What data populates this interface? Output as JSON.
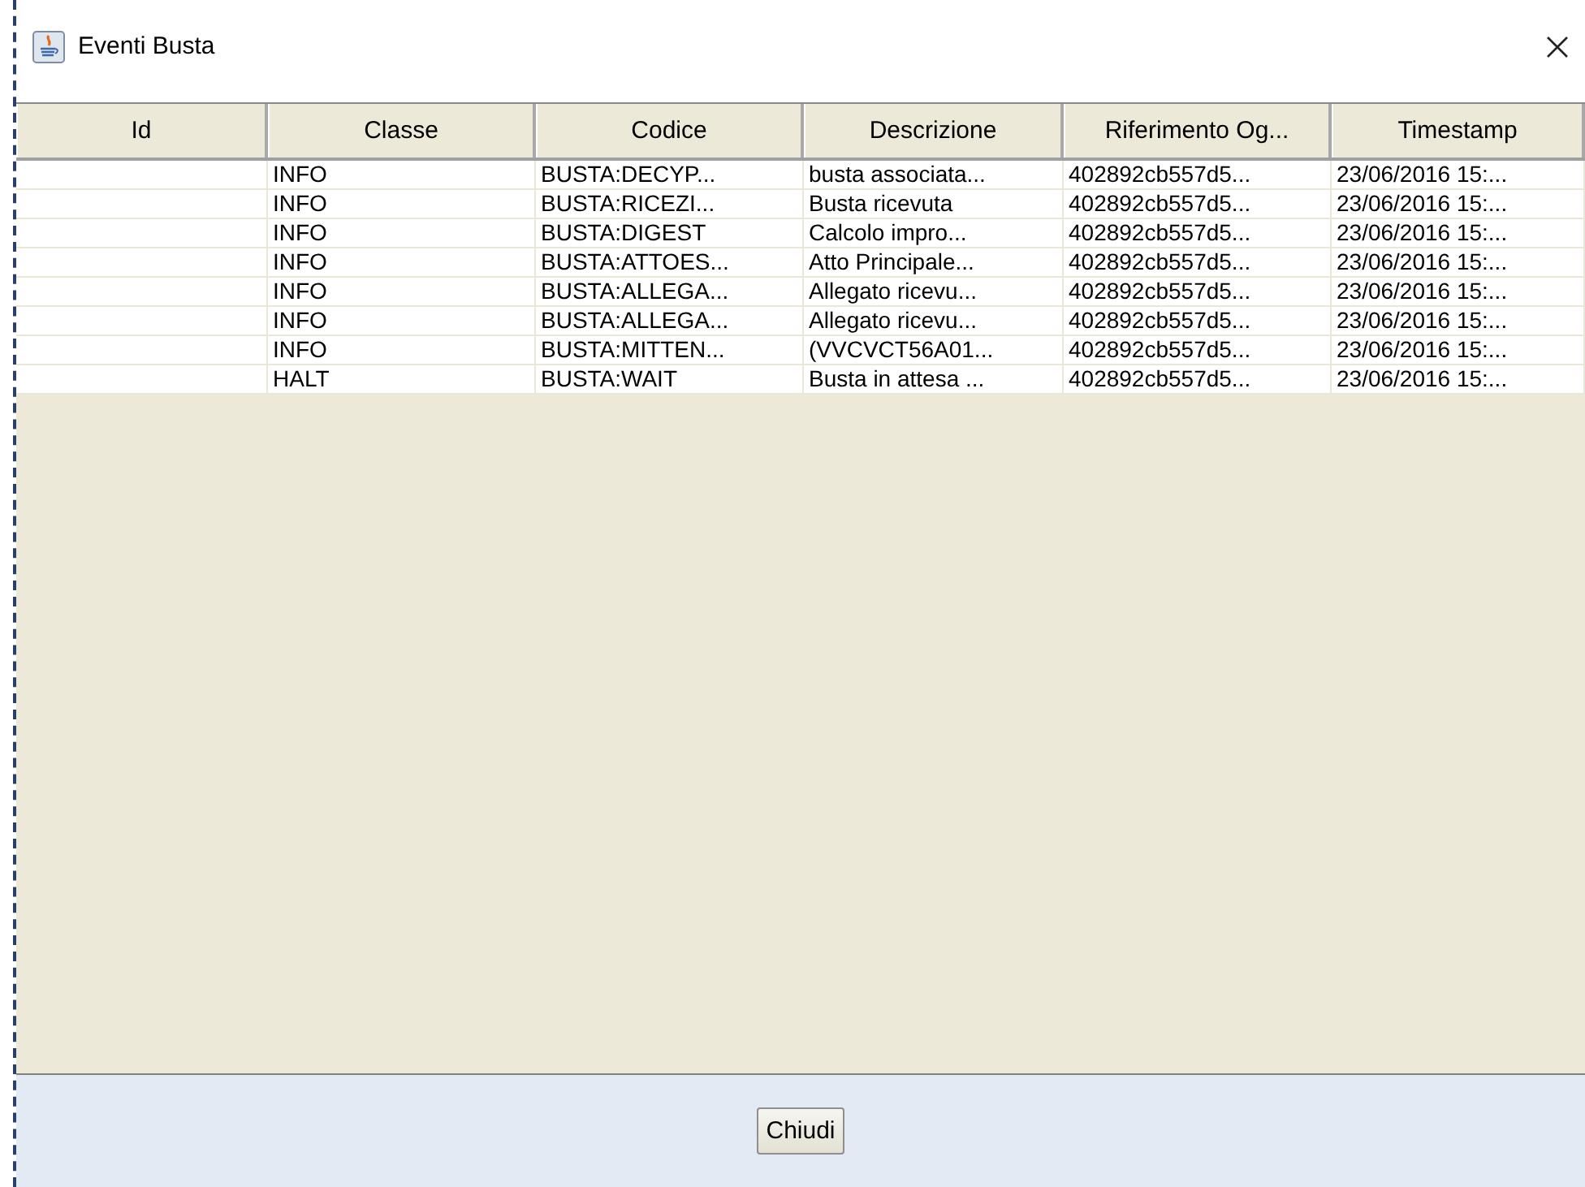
{
  "window": {
    "title": "Eventi Busta"
  },
  "table": {
    "columns": [
      "Id",
      "Classe",
      "Codice",
      "Descrizione",
      "Riferimento Og...",
      "Timestamp"
    ],
    "rows": [
      {
        "classe": "INFO",
        "codice": "BUSTA:DECYP...",
        "descrizione": "busta associata...",
        "riferimento": "402892cb557d5...",
        "timestamp": "23/06/2016 15:..."
      },
      {
        "classe": "INFO",
        "codice": "BUSTA:RICEZI...",
        "descrizione": "Busta ricevuta",
        "riferimento": "402892cb557d5...",
        "timestamp": "23/06/2016 15:..."
      },
      {
        "classe": "INFO",
        "codice": "BUSTA:DIGEST",
        "descrizione": "Calcolo impro...",
        "riferimento": "402892cb557d5...",
        "timestamp": "23/06/2016 15:..."
      },
      {
        "classe": "INFO",
        "codice": "BUSTA:ATTOES...",
        "descrizione": "Atto Principale...",
        "riferimento": "402892cb557d5...",
        "timestamp": "23/06/2016 15:..."
      },
      {
        "classe": "INFO",
        "codice": "BUSTA:ALLEGA...",
        "descrizione": "Allegato ricevu...",
        "riferimento": "402892cb557d5...",
        "timestamp": "23/06/2016 15:..."
      },
      {
        "classe": "INFO",
        "codice": "BUSTA:ALLEGA...",
        "descrizione": "Allegato ricevu...",
        "riferimento": "402892cb557d5...",
        "timestamp": "23/06/2016 15:..."
      },
      {
        "classe": "INFO",
        "codice": "BUSTA:MITTEN...",
        "descrizione": "(VVCVCT56A01...",
        "riferimento": "402892cb557d5...",
        "timestamp": "23/06/2016 15:..."
      },
      {
        "classe": "HALT",
        "codice": "BUSTA:WAIT",
        "descrizione": "Busta in attesa ...",
        "riferimento": "402892cb557d5...",
        "timestamp": "23/06/2016 15:..."
      }
    ]
  },
  "buttons": [
    "Chiudi"
  ]
}
